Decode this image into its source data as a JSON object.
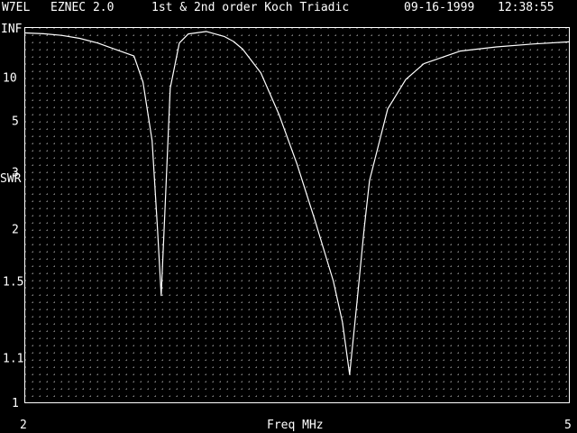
{
  "header": {
    "callsign": "W7EL",
    "program": "EZNEC 2.0",
    "title": "1st & 2nd order Koch Triadic",
    "date": "09-16-1999",
    "time": "12:38:55"
  },
  "chart_data": {
    "type": "line",
    "title": "1st & 2nd order Koch Triadic",
    "xlabel": "Freq MHz",
    "ylabel": "SWR",
    "xlim": [
      2,
      5
    ],
    "yscale": "swr",
    "x_tick_labels": [
      "2",
      "5"
    ],
    "y_tick_labels": [
      "INF",
      "10",
      "5",
      "3",
      "2",
      "1.5",
      "1.1",
      "1"
    ],
    "grid": "dotted",
    "colors": {
      "background": "#000000",
      "trace": "#ffffff",
      "grid": "#9a9a9a"
    },
    "series": [
      {
        "x": [
          2.0,
          2.1,
          2.2,
          2.3,
          2.4,
          2.6,
          2.65,
          2.7,
          2.73,
          2.75,
          2.77,
          2.8,
          2.85,
          2.9,
          3.0,
          3.1,
          3.15,
          3.2,
          3.3,
          3.4,
          3.5,
          3.6,
          3.7,
          3.75,
          3.79,
          3.83,
          3.87,
          3.9,
          4.0,
          4.1,
          4.2,
          4.4,
          4.6,
          4.8,
          5.0
        ],
        "y": [
          105,
          90,
          70,
          50,
          34,
          18,
          9,
          4,
          2.0,
          1.4,
          2.2,
          8,
          34,
          88,
          150,
          60,
          38,
          24,
          11,
          5.4,
          3.2,
          2.1,
          1.5,
          1.25,
          1.05,
          1.35,
          2.0,
          2.8,
          5.8,
          9.5,
          14,
          22,
          27,
          32,
          37
        ]
      }
    ]
  }
}
